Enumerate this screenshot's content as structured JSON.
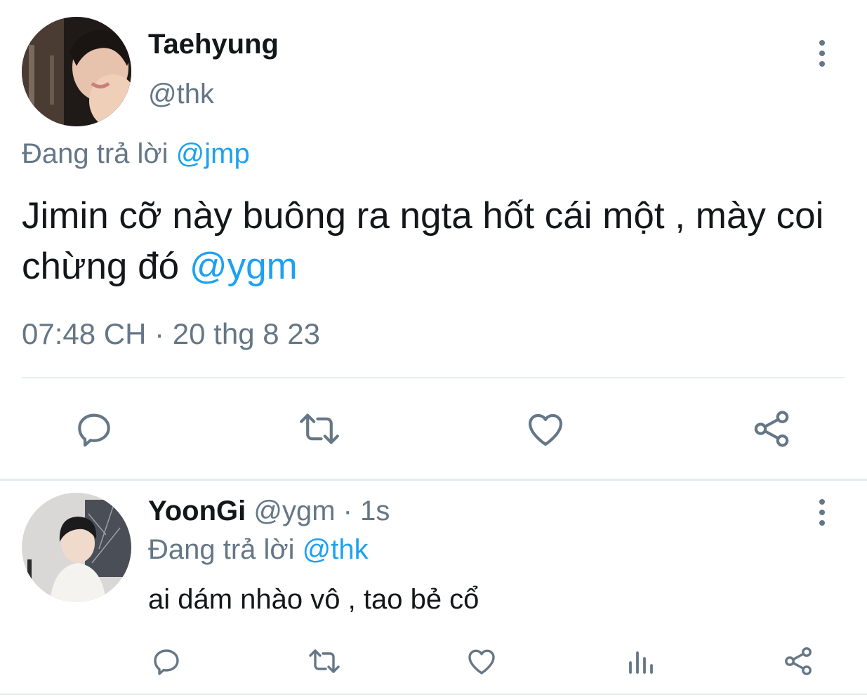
{
  "main_tweet": {
    "author_name": "Taehyung",
    "handle": "@thk",
    "replying_prefix": "Đang trả lời",
    "replying_to": "@jmp",
    "text_main": "Jimin cỡ này buông ra ngta hốt cái một , mày coi chừng đó",
    "text_mention": "@ygm",
    "time": "07:48 CH",
    "separator": "·",
    "date": "20 thg 8 23",
    "actions": [
      "reply-icon",
      "retweet-icon",
      "like-icon",
      "share-icon"
    ]
  },
  "reply_tweet": {
    "author_name": "YoonGi",
    "handle": "@ygm",
    "meta_sep": "·",
    "age": "1s",
    "replying_prefix": "Đang trả lời",
    "replying_to": "@thk",
    "text": "ai dám nhào vô , tao bẻ cổ",
    "actions": [
      "reply-icon",
      "retweet-icon",
      "like-icon",
      "analytics-icon",
      "share-icon"
    ]
  },
  "colors": {
    "text": "#14171a",
    "secondary": "#657786",
    "link": "#1da1f2",
    "divider": "#e6ecf0"
  }
}
